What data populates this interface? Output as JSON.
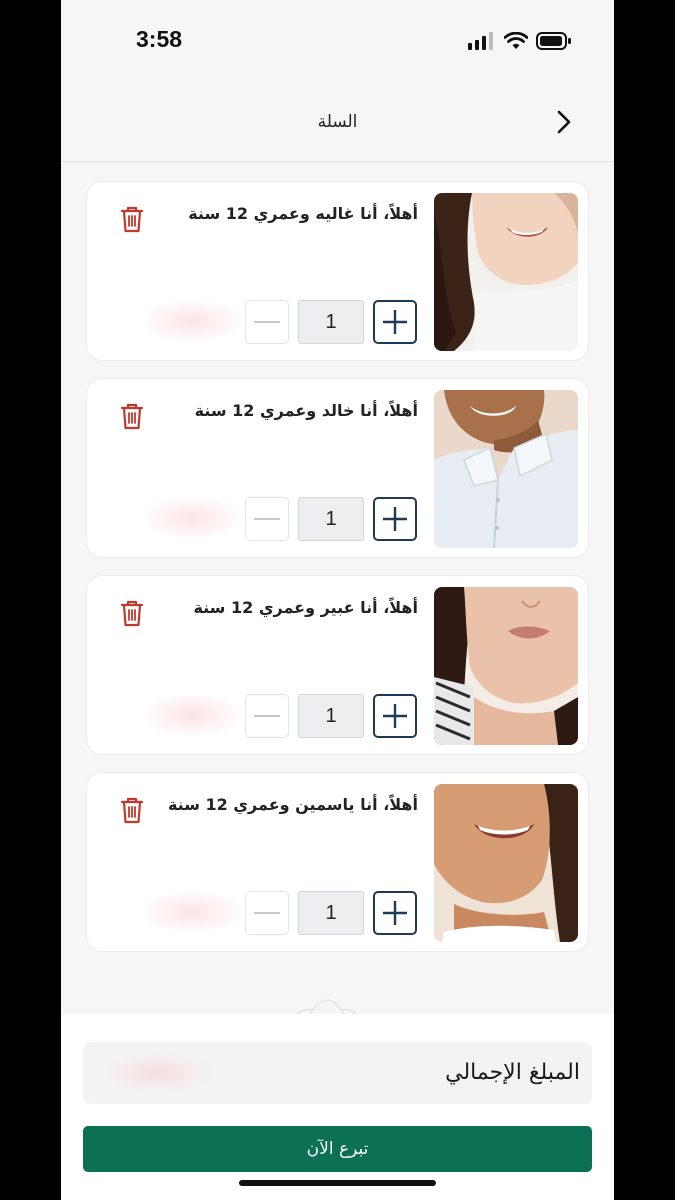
{
  "status_bar": {
    "time": "3:58"
  },
  "header": {
    "title": "السلة"
  },
  "cart": {
    "items": [
      {
        "title": "أهلاً، أنا غاليه وعمري 12 سنة",
        "quantity": "1"
      },
      {
        "title": "أهلاً، أنا خالد وعمري 12 سنة",
        "quantity": "1"
      },
      {
        "title": "أهلاً، أنا عبير وعمري 12 سنة",
        "quantity": "1"
      },
      {
        "title": "أهلاً، أنا ياسمين وعمري 12 سنة",
        "quantity": "1"
      }
    ]
  },
  "footer": {
    "total_label": "المبلغ الإجمالي",
    "donate_label": "تبرع الآن"
  },
  "colors": {
    "accent_green": "#0b7054",
    "stepper_navy": "#1d3b57",
    "trash_red": "#c0392b"
  }
}
